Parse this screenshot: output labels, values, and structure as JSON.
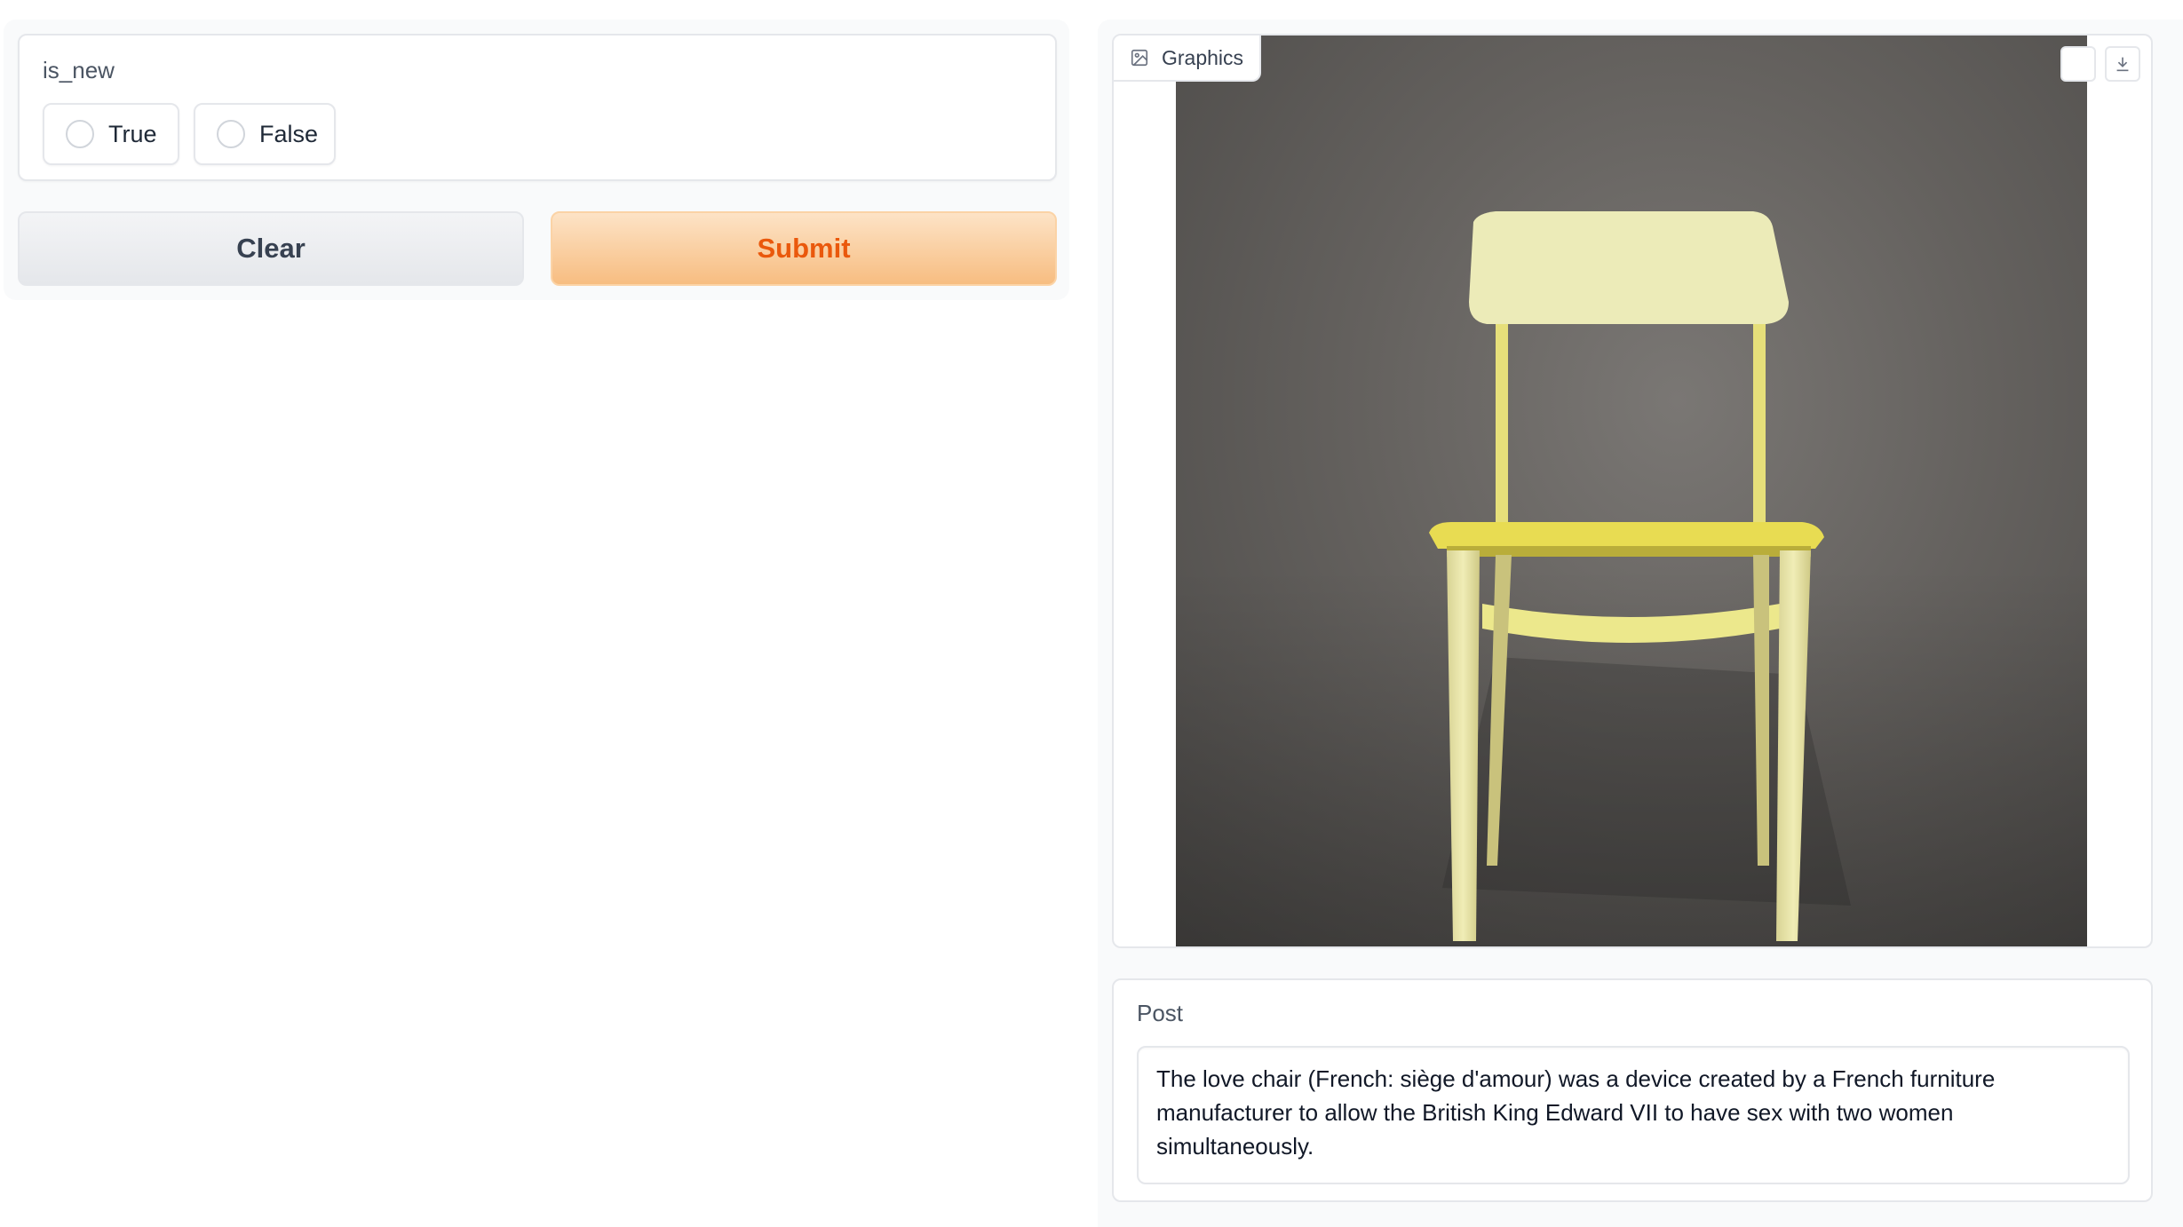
{
  "inputs": {
    "label": "is_new",
    "options": [
      "True",
      "False"
    ]
  },
  "buttons": {
    "clear": "Clear",
    "submit": "Submit"
  },
  "outputs": {
    "image_label": "Graphics",
    "image_subject": "yellow wooden chair on grey backdrop",
    "post_label": "Post",
    "post_text": "The love chair (French: siège d'amour) was a device created by a French furniture manufacturer to allow the British King Edward VII to have sex with two women simultaneously."
  },
  "icons": {
    "image_label_icon": "image-icon",
    "fullscreen": "fullscreen-icon",
    "download": "download-icon"
  },
  "colors": {
    "submit_text": "#ea580c",
    "submit_bg": "#f7bd81",
    "clear_bg": "#e5e7eb"
  }
}
